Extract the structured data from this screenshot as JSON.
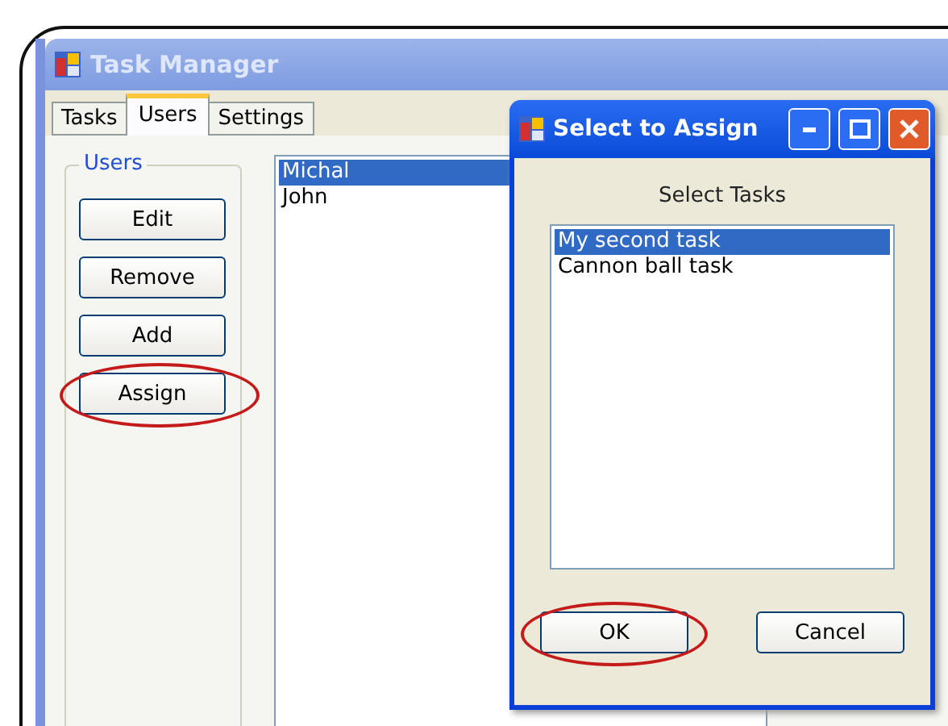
{
  "window": {
    "title": "Task Manager",
    "tabs": [
      {
        "label": "Tasks",
        "selected": false
      },
      {
        "label": "Users",
        "selected": true
      },
      {
        "label": "Settings",
        "selected": false
      }
    ],
    "group": {
      "label": "Users"
    },
    "buttons": [
      {
        "label": "Edit",
        "highlighted": false
      },
      {
        "label": "Remove",
        "highlighted": false
      },
      {
        "label": "Add",
        "highlighted": false
      },
      {
        "label": "Assign",
        "highlighted": true
      }
    ],
    "users": [
      {
        "name": "Michal",
        "selected": true
      },
      {
        "name": "John",
        "selected": false
      }
    ]
  },
  "dialog": {
    "title": "Select to Assign",
    "heading": "Select Tasks",
    "tasks": [
      {
        "name": "My second task",
        "selected": true
      },
      {
        "name": "Cannon ball task",
        "selected": false
      }
    ],
    "buttons": [
      {
        "label": "OK",
        "highlighted": true
      },
      {
        "label": "Cancel",
        "highlighted": false
      }
    ]
  }
}
